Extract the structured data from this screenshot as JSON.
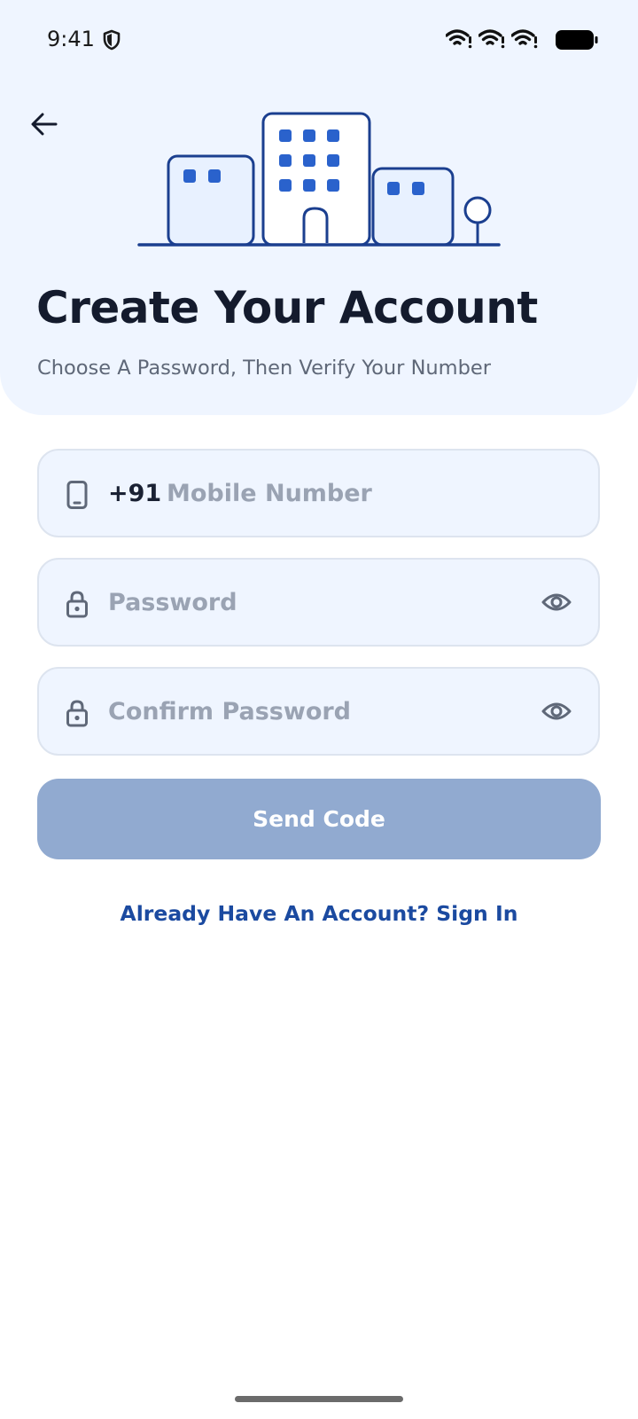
{
  "status_bar": {
    "time": "9:41"
  },
  "header": {
    "title": "Create Your Account",
    "subtitle": "Choose A Password, Then Verify Your Number"
  },
  "form": {
    "mobile": {
      "prefix": "+91",
      "value": "",
      "placeholder": "Mobile Number",
      "icon": "phone-icon"
    },
    "password": {
      "value": "",
      "placeholder": "Password",
      "icon": "lock-icon",
      "toggle_icon": "eye-icon"
    },
    "confirm_password": {
      "value": "",
      "placeholder": "Confirm Password",
      "icon": "lock-icon",
      "toggle_icon": "eye-icon"
    },
    "send_button_label": "Send Code"
  },
  "footer": {
    "signin_label": "Already Have An Account? Sign In"
  },
  "colors": {
    "header_bg": "#eff5ff",
    "field_bg": "#eff5ff",
    "button_disabled": "#91aad0",
    "link": "#1b4aa0",
    "illustration_stroke": "#1b3f8f",
    "illustration_window": "#2a62cc"
  }
}
